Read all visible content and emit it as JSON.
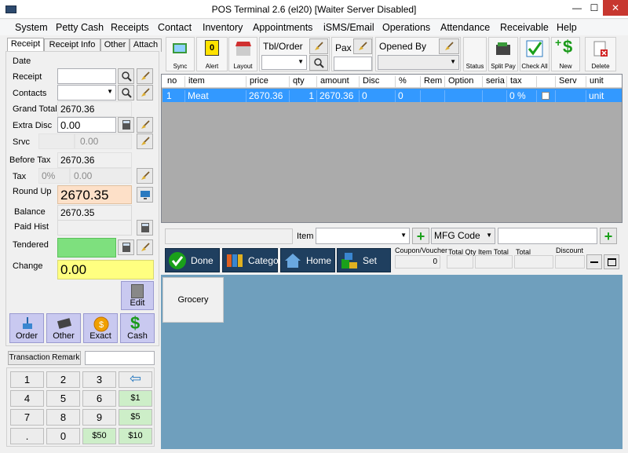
{
  "window": {
    "title": "POS Terminal 2.6 (el20) [Waiter Server Disabled]",
    "min": "—",
    "max": "☐",
    "close": "✕"
  },
  "menu": [
    "System",
    "Petty Cash",
    "Receipts",
    "Contact",
    "Inventory",
    "Appointments",
    "iSMS/Email",
    "Operations",
    "Attendance",
    "Receivable",
    "Help"
  ],
  "tabs": [
    "Receipt",
    "Receipt Info",
    "Other",
    "Attach"
  ],
  "left": {
    "date_label": "Date",
    "receipt_label": "Receipt",
    "contacts_label": "Contacts",
    "grand_total_label": "Grand Total",
    "grand_total": "2670.36",
    "extra_disc_label": "Extra Disc",
    "extra_disc": "0.00",
    "srvc_label": "Srvc",
    "srvc": "0.00",
    "before_tax_label": "Before Tax",
    "before_tax": "2670.36",
    "tax_label": "Tax",
    "tax_pct": "0%",
    "tax": "0.00",
    "round_up_label": "Round Up",
    "round_up": "2670.35",
    "balance_label": "Balance",
    "balance": "2670.35",
    "paid_hist_label": "Paid Hist",
    "tendered_label": "Tendered",
    "change_label": "Change",
    "change": "0.00",
    "edit_label": "Edit"
  },
  "pay_buttons": [
    "Order",
    "Other",
    "Exact",
    "Cash"
  ],
  "transaction_remark": "Transaction Remark",
  "keypad": {
    "rows": [
      [
        "1",
        "2",
        "3"
      ],
      [
        "4",
        "5",
        "6"
      ],
      [
        "7",
        "8",
        "9"
      ],
      [
        ".",
        "0"
      ]
    ],
    "green": [
      "$1",
      "$5",
      "$50",
      "$10"
    ]
  },
  "toolbar": {
    "sync": "Sync",
    "alert": "Alert",
    "alert_count": "0",
    "layout": "Layout",
    "tbl_order": "Tbl/Order",
    "pax": "Pax",
    "opened_by": "Opened By",
    "status": "Status",
    "split_pay": "Split Pay",
    "check_all": "Check All",
    "new": "New",
    "delete": "Delete"
  },
  "grid": {
    "columns": [
      "no",
      "item",
      "price",
      "qty",
      "amount",
      "Disc",
      "%",
      "Rem",
      "Option",
      "seria",
      "tax",
      "",
      "Serv",
      "unit"
    ],
    "rows": [
      {
        "no": "1",
        "item": "Meat",
        "price": "2670.36",
        "qty": "1",
        "amount": "2670.36",
        "disc": "0",
        "pct": "0",
        "tax": "0 %",
        "unit": "unit"
      }
    ]
  },
  "entry": {
    "item_label": "Item",
    "mfg_code": "MFG Code"
  },
  "actions": {
    "done": "Done",
    "category": "Category",
    "home": "Home",
    "set": "Set"
  },
  "totals": {
    "coupon_label": "Coupon/Voucher",
    "coupon": "0",
    "total_qty_label": "Total Qty",
    "item_total_label": "Item Total",
    "total_label": "Total",
    "discount_label": "Discount"
  },
  "categories": [
    "Grocery"
  ],
  "colors": {
    "selection": "#3399ff",
    "action": "#1f3f5f",
    "category_area": "#6f9fbd",
    "round_up": "#fde0c8",
    "tendered": "#7ee07e",
    "change": "#ffff80"
  }
}
